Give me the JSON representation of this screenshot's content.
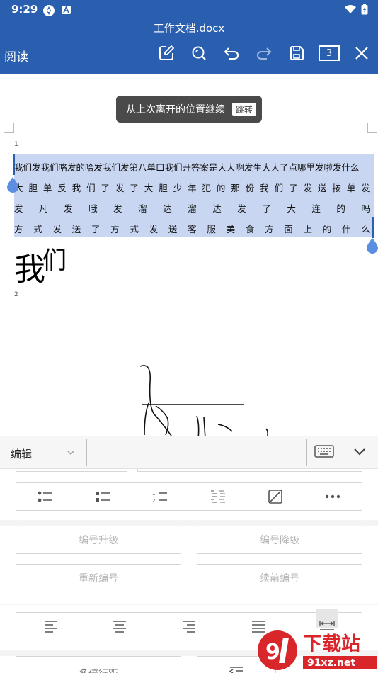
{
  "status_bar": {
    "time": "9:29",
    "icons": [
      "settings-app-icon",
      "a-app-icon"
    ],
    "right_icons": [
      "wifi-icon",
      "battery-icon"
    ]
  },
  "app_bar": {
    "doc_title": "工作文档.docx",
    "mode_label": "阅读",
    "page_count": "3",
    "tools": [
      "edit-icon",
      "search-icon",
      "undo-icon",
      "redo-icon",
      "save-icon",
      "page-count",
      "close-icon"
    ]
  },
  "document": {
    "toast": {
      "text": "从上次离开的位置继续",
      "action": "跳转"
    },
    "para1_number": "1",
    "para2_number": "2",
    "lines": [
      "我们发我们咯发的哈发我们发第八单口我们开答案是大大啊发生大大了点哪里发啦发什么",
      "大胆单反我们了发了大胆少年犯的那份我们了发送按单发",
      "发凡发哦发溜达溜达发了大连的吗",
      "方式发送了方式发送客服美食方面上的什么"
    ],
    "big_text": "我",
    "big_text_super": "们"
  },
  "panel": {
    "select_label": "编辑",
    "buttons": {
      "promote": "编号升级",
      "demote": "编号降级",
      "renumber": "重新编号",
      "continue_numbering": "续前编号",
      "multi_line_spacing": "多倍行距"
    },
    "list_icons": [
      "bullet-list-icon",
      "square-bullet-list-icon",
      "numbered-list-icon",
      "multilevel-list-icon",
      "no-list-icon",
      "more-icon"
    ],
    "align_icons": [
      "align-left-icon",
      "align-center-icon",
      "align-right-icon",
      "align-justify-icon",
      "distributed-align-icon"
    ]
  },
  "watermark": {
    "text": "下载站",
    "sub": "91xz.net"
  },
  "colors": {
    "app_bar": "#2a5fb0",
    "selection": "#c8d6f2",
    "accent": "#2a5fb0",
    "watermark_red": "#d9262b"
  }
}
